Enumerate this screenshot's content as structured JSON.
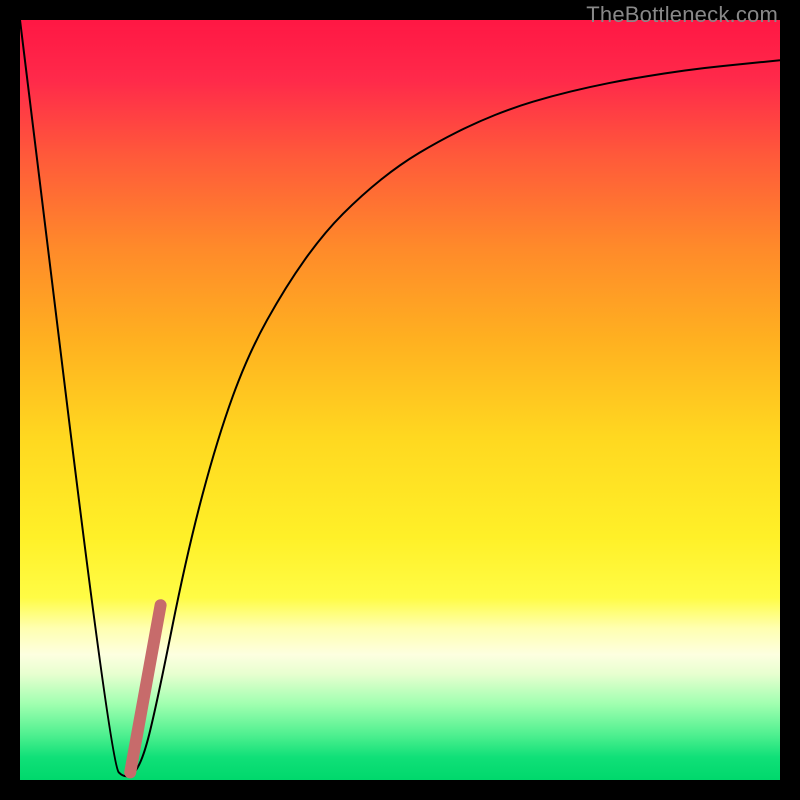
{
  "watermark": "TheBottleneck.com",
  "chart_data": {
    "type": "line",
    "title": "",
    "xlabel": "",
    "ylabel": "",
    "xlim": [
      0,
      100
    ],
    "ylim": [
      0,
      100
    ],
    "background_gradient": {
      "stops": [
        {
          "offset": 0.0,
          "color": "#ff1744"
        },
        {
          "offset": 0.08,
          "color": "#ff2a4a"
        },
        {
          "offset": 0.18,
          "color": "#ff5a3a"
        },
        {
          "offset": 0.3,
          "color": "#ff8a2a"
        },
        {
          "offset": 0.42,
          "color": "#ffb020"
        },
        {
          "offset": 0.55,
          "color": "#ffd820"
        },
        {
          "offset": 0.68,
          "color": "#fff028"
        },
        {
          "offset": 0.76,
          "color": "#fffc45"
        },
        {
          "offset": 0.8,
          "color": "#ffffb0"
        },
        {
          "offset": 0.835,
          "color": "#fdffe0"
        },
        {
          "offset": 0.86,
          "color": "#e8ffd0"
        },
        {
          "offset": 0.9,
          "color": "#a0ffb0"
        },
        {
          "offset": 0.94,
          "color": "#50f090"
        },
        {
          "offset": 0.97,
          "color": "#10e078"
        },
        {
          "offset": 1.0,
          "color": "#00d86c"
        }
      ]
    },
    "series": [
      {
        "name": "bottleneck-curve",
        "color": "#000000",
        "stroke_width": 2,
        "x": [
          0,
          12,
          14,
          16,
          18,
          22,
          26,
          30,
          35,
          40,
          45,
          50,
          55,
          60,
          65,
          70,
          75,
          80,
          85,
          90,
          95,
          100
        ],
        "y": [
          100,
          2,
          0,
          2,
          10,
          30,
          45,
          56,
          65,
          72,
          77,
          81,
          84,
          86.5,
          88.5,
          90,
          91.2,
          92.2,
          93,
          93.7,
          94.2,
          94.7
        ]
      },
      {
        "name": "highlight-segment",
        "color": "#c76b6b",
        "stroke_width": 12,
        "stroke_linecap": "round",
        "x": [
          14.5,
          18.5
        ],
        "y": [
          1,
          23
        ]
      }
    ]
  }
}
